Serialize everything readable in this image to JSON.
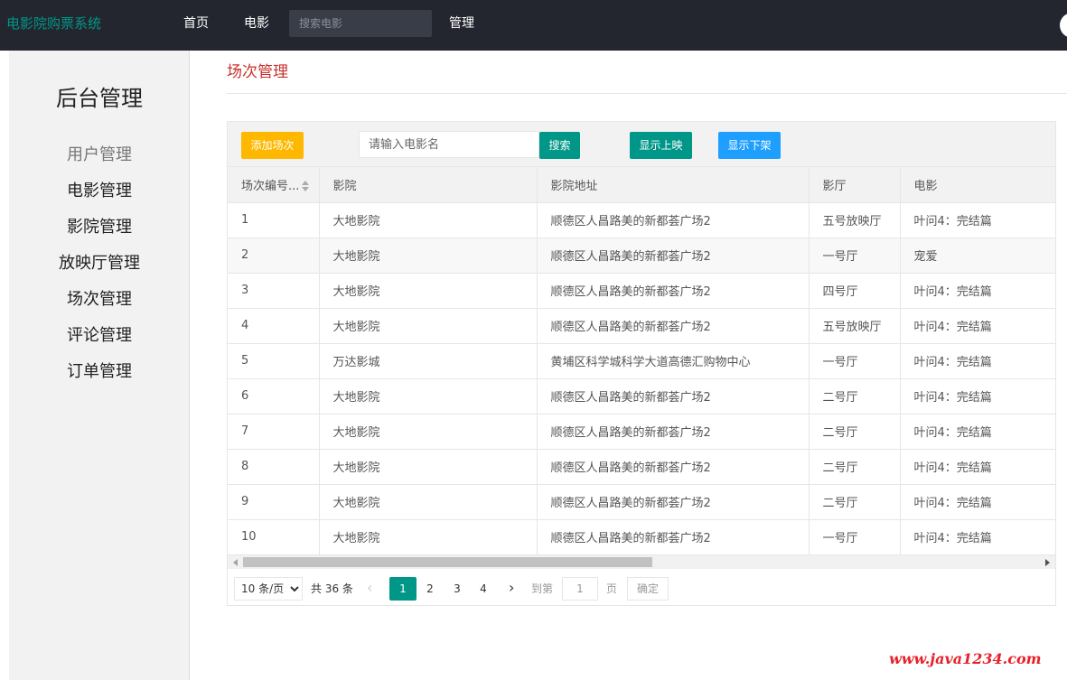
{
  "nav": {
    "brand": "电影院购票系统",
    "home": "首页",
    "movie": "电影",
    "search_placeholder": "搜索电影",
    "manage": "管理"
  },
  "sidebar": {
    "title": "后台管理",
    "items": [
      {
        "label": "用户管理"
      },
      {
        "label": "电影管理"
      },
      {
        "label": "影院管理"
      },
      {
        "label": "放映厅管理"
      },
      {
        "label": "场次管理"
      },
      {
        "label": "评论管理"
      },
      {
        "label": "订单管理"
      }
    ]
  },
  "page": {
    "title": "场次管理"
  },
  "toolbar": {
    "add_label": "添加场次",
    "keyword_placeholder": "请输入电影名",
    "search_label": "搜索",
    "onshow_label": "显示上映",
    "offshow_label": "显示下架"
  },
  "table": {
    "headers": [
      "场次编号...",
      "影院",
      "影院地址",
      "影厅",
      "电影"
    ],
    "rows": [
      [
        "1",
        "大地影院",
        "顺德区人昌路美的新都荟广场2",
        "五号放映厅",
        "叶问4：完结篇"
      ],
      [
        "2",
        "大地影院",
        "顺德区人昌路美的新都荟广场2",
        "一号厅",
        "宠爱"
      ],
      [
        "3",
        "大地影院",
        "顺德区人昌路美的新都荟广场2",
        "四号厅",
        "叶问4：完结篇"
      ],
      [
        "4",
        "大地影院",
        "顺德区人昌路美的新都荟广场2",
        "五号放映厅",
        "叶问4：完结篇"
      ],
      [
        "5",
        "万达影城",
        "黄埔区科学城科学大道高德汇购物中心",
        "一号厅",
        "叶问4：完结篇"
      ],
      [
        "6",
        "大地影院",
        "顺德区人昌路美的新都荟广场2",
        "二号厅",
        "叶问4：完结篇"
      ],
      [
        "7",
        "大地影院",
        "顺德区人昌路美的新都荟广场2",
        "二号厅",
        "叶问4：完结篇"
      ],
      [
        "8",
        "大地影院",
        "顺德区人昌路美的新都荟广场2",
        "二号厅",
        "叶问4：完结篇"
      ],
      [
        "9",
        "大地影院",
        "顺德区人昌路美的新都荟广场2",
        "二号厅",
        "叶问4：完结篇"
      ],
      [
        "10",
        "大地影院",
        "顺德区人昌路美的新都荟广场2",
        "一号厅",
        "叶问4：完结篇"
      ]
    ]
  },
  "pager": {
    "page_size": "10 条/页",
    "total": "共 36 条",
    "pages": [
      "1",
      "2",
      "3",
      "4"
    ],
    "current": "1",
    "goto_label": "到第",
    "goto_value": "1",
    "unit": "页",
    "confirm": "确定"
  },
  "watermark": "www.java1234.com",
  "colors": {
    "nav_bg": "#23262e",
    "brand": "#009688",
    "title_red": "#c9302c",
    "btn_warm": "#ffb800",
    "btn_primary": "#009688",
    "btn_normal": "#1e9fff"
  }
}
